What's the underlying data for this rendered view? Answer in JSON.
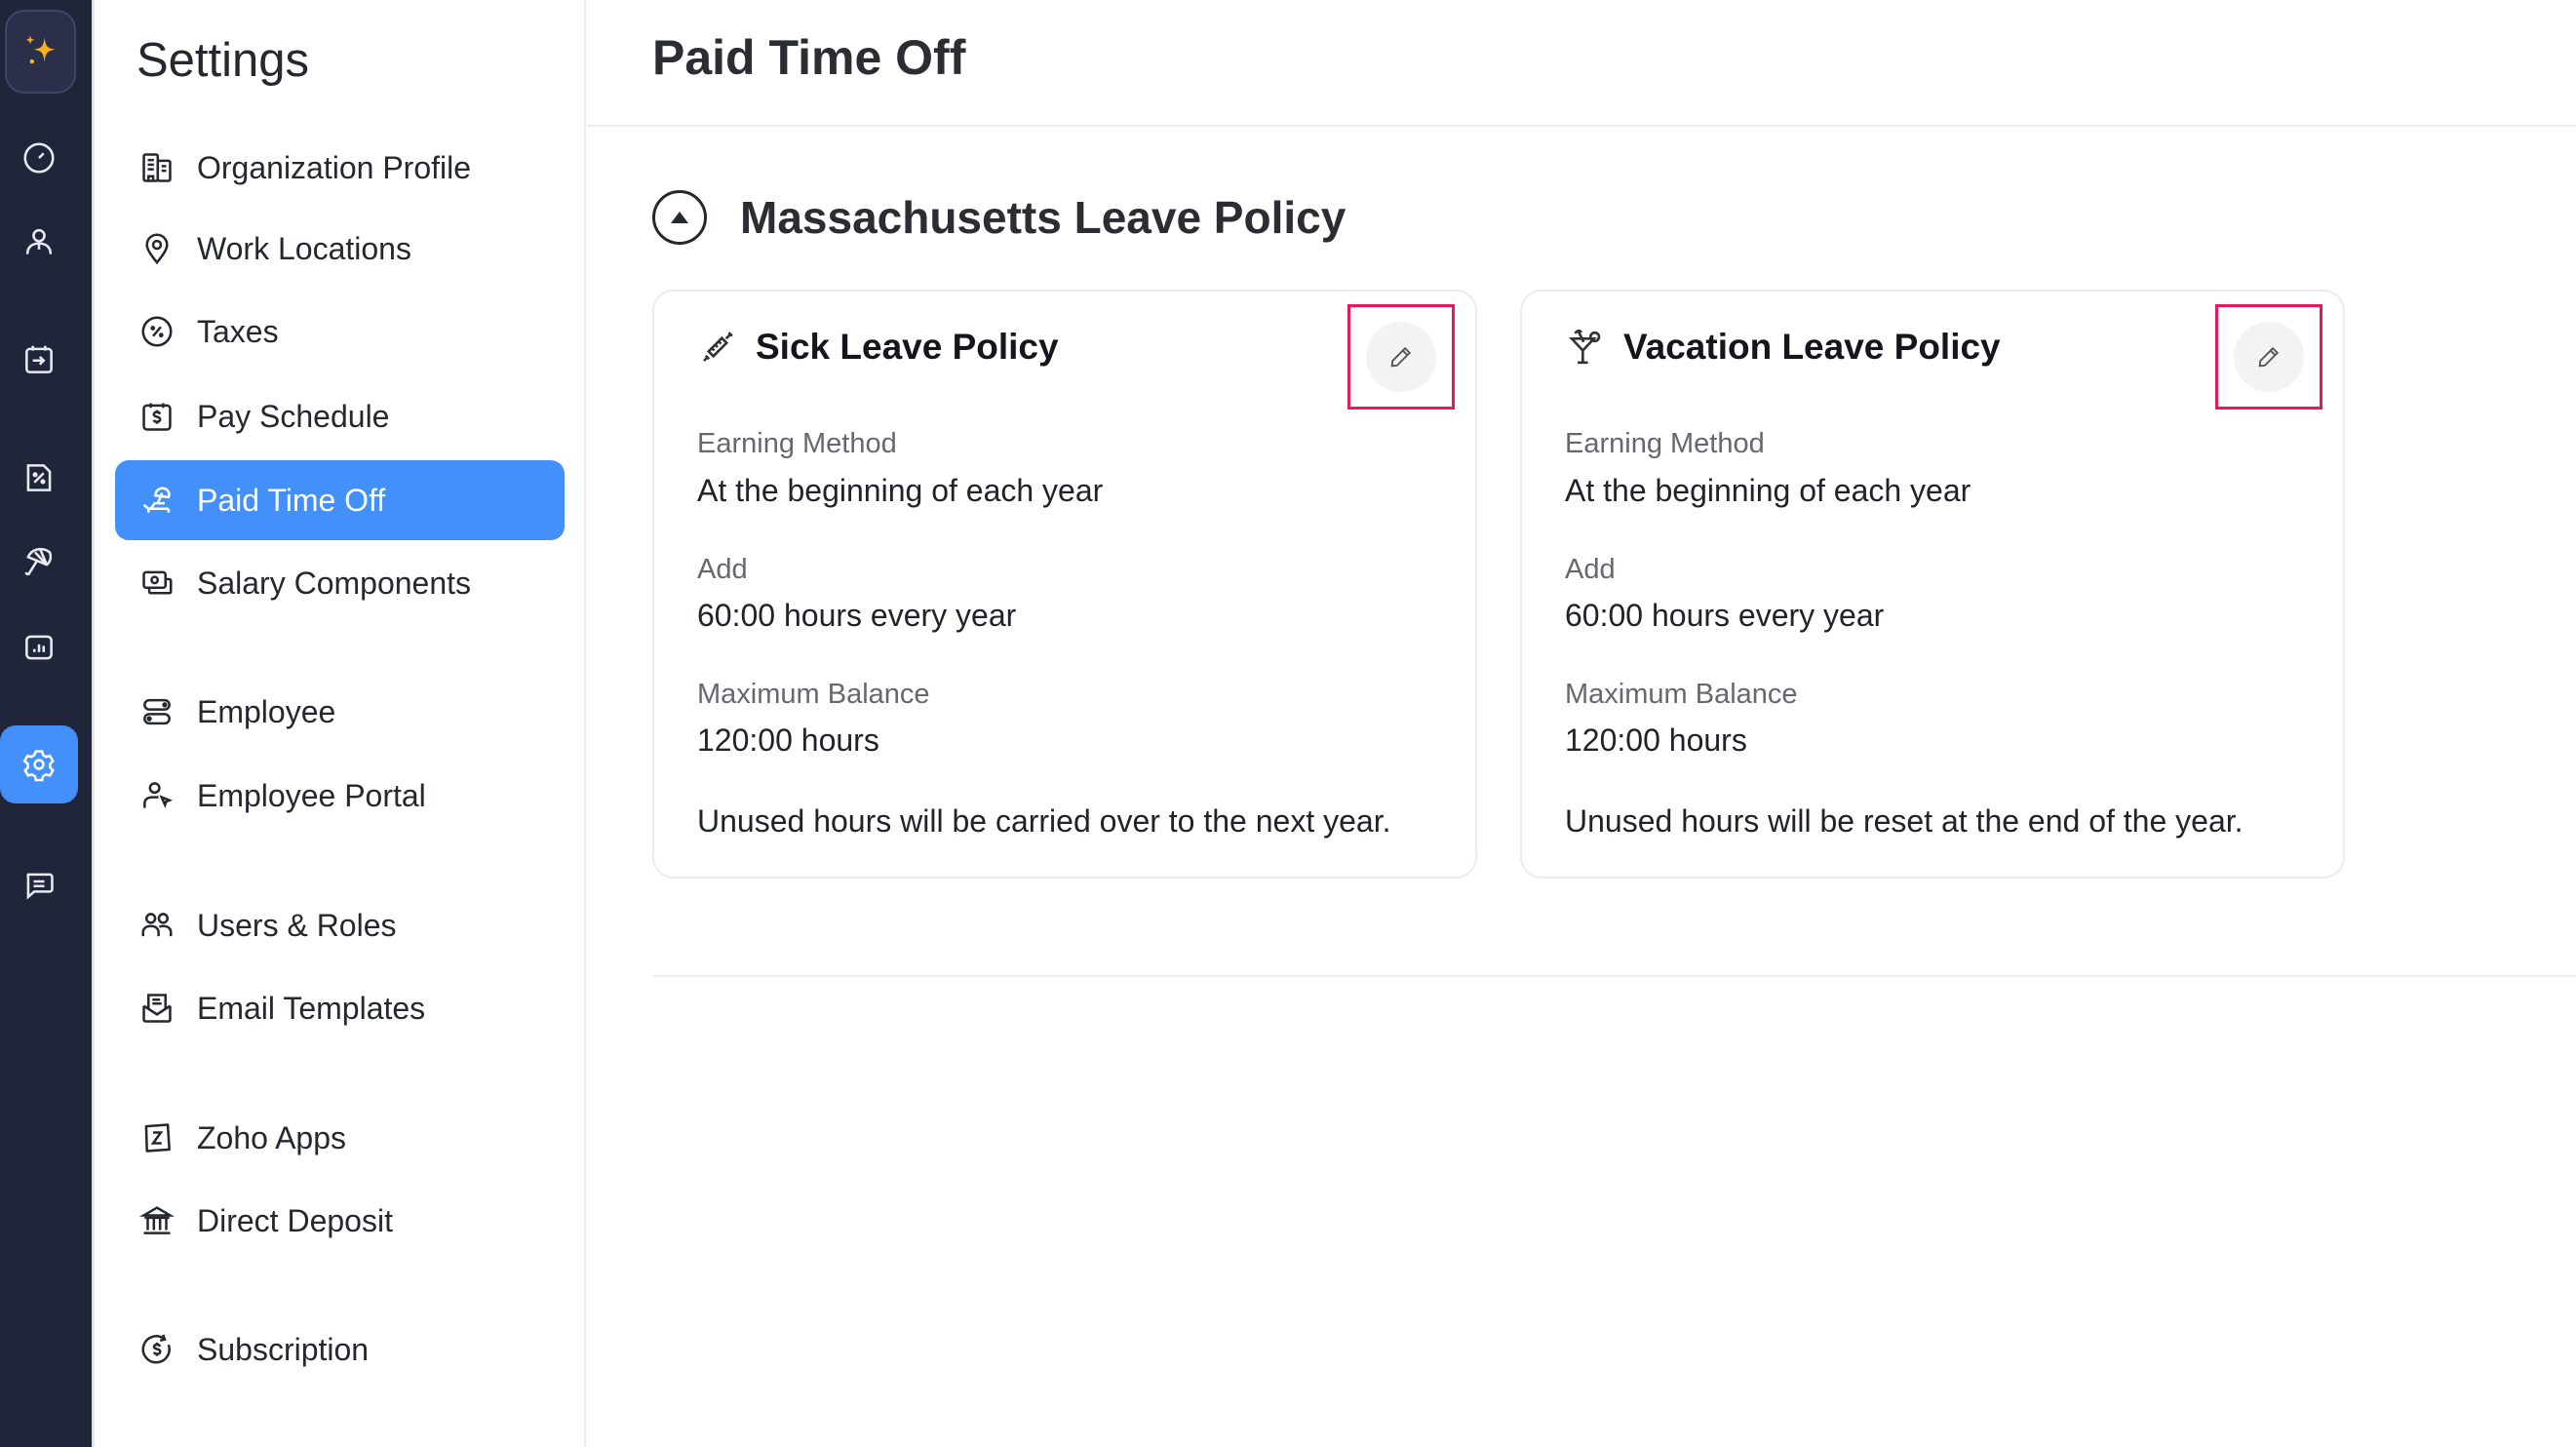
{
  "rail": {
    "items": [
      {
        "name": "ai-assistant",
        "icon": "sparkle-icon",
        "active": false
      },
      {
        "name": "dashboard",
        "icon": "gauge-icon",
        "active": false
      },
      {
        "name": "employees",
        "icon": "person-icon",
        "active": false
      },
      {
        "name": "pay-runs",
        "icon": "calendar-arrow-icon",
        "active": false
      },
      {
        "name": "taxes",
        "icon": "percent-document-icon",
        "active": false
      },
      {
        "name": "benefits",
        "icon": "umbrella-icon",
        "active": false
      },
      {
        "name": "reports",
        "icon": "bar-chart-icon",
        "active": false
      },
      {
        "name": "settings",
        "icon": "gear-icon",
        "active": true
      },
      {
        "name": "feedback",
        "icon": "chat-icon",
        "active": false
      }
    ],
    "colors": {
      "background": "#21253a",
      "active": "#4390fb",
      "logo": "#fbb01d"
    }
  },
  "sidebar": {
    "title": "Settings",
    "items": [
      {
        "label": "Organization Profile",
        "icon": "building-icon",
        "active": false
      },
      {
        "label": "Work Locations",
        "icon": "location-pin-icon",
        "active": false
      },
      {
        "label": "Taxes",
        "icon": "percent-circle-icon",
        "active": false
      },
      {
        "label": "Pay Schedule",
        "icon": "dollar-calendar-icon",
        "active": false
      },
      {
        "label": "Paid Time Off",
        "icon": "beach-chair-icon",
        "active": true
      },
      {
        "label": "Salary Components",
        "icon": "money-icon",
        "active": false
      },
      {
        "label": "Employee",
        "icon": "toggles-icon",
        "active": false
      },
      {
        "label": "Employee Portal",
        "icon": "user-pointer-icon",
        "active": false
      },
      {
        "label": "Users & Roles",
        "icon": "users-icon",
        "active": false
      },
      {
        "label": "Email Templates",
        "icon": "envelope-icon",
        "active": false
      },
      {
        "label": "Zoho Apps",
        "icon": "zoho-z-icon",
        "active": false
      },
      {
        "label": "Direct Deposit",
        "icon": "bank-icon",
        "active": false
      },
      {
        "label": "Subscription",
        "icon": "subscription-dollar-icon",
        "active": false
      }
    ]
  },
  "main": {
    "title": "Paid Time Off",
    "section": {
      "title": "Massachusetts Leave Policy",
      "toggle_icon": "collapse-up-icon",
      "policies": [
        {
          "title": "Sick Leave Policy",
          "icon": "syringe-icon",
          "edit_icon": "pencil-icon",
          "earning_method_label": "Earning Method",
          "earning_method_value": "At the beginning of each year",
          "add_label": "Add",
          "add_value": "60:00 hours every year",
          "max_balance_label": "Maximum Balance",
          "max_balance_value": "120:00 hours",
          "note": "Unused hours will be carried over to the next year."
        },
        {
          "title": "Vacation Leave Policy",
          "icon": "cocktail-icon",
          "edit_icon": "pencil-icon",
          "earning_method_label": "Earning Method",
          "earning_method_value": "At the beginning of each year",
          "add_label": "Add",
          "add_value": "60:00 hours every year",
          "max_balance_label": "Maximum Balance",
          "max_balance_value": "120:00 hours",
          "note": "Unused hours will be reset at the end of the year."
        }
      ]
    },
    "highlight_color": "#e8185d"
  }
}
